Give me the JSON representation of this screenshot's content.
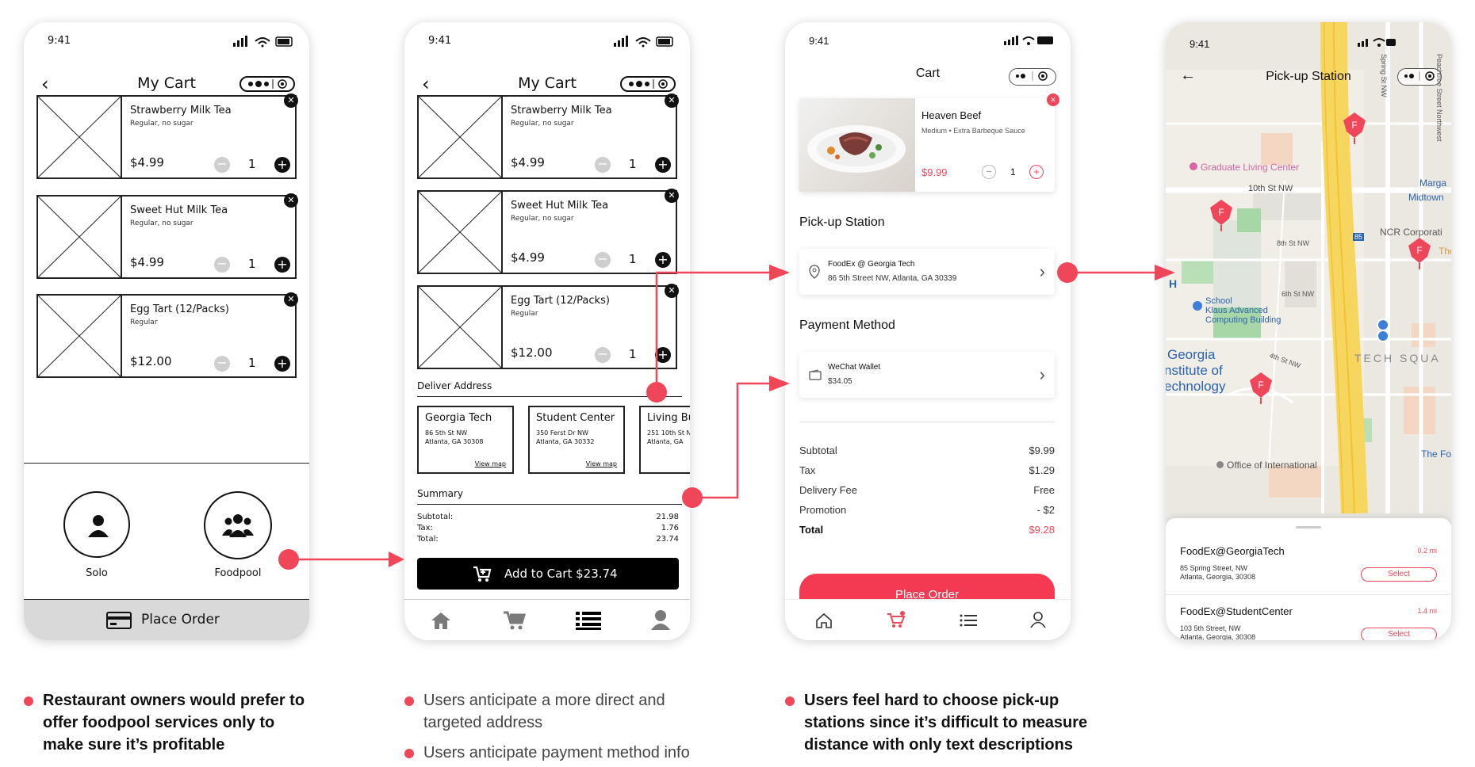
{
  "status_time": "9:41",
  "phone1": {
    "title": "My Cart",
    "items": [
      {
        "name": "Strawberry Milk Tea",
        "option": "Regular, no sugar",
        "price": "$4.99",
        "qty": "1"
      },
      {
        "name": "Sweet Hut Milk Tea",
        "option": "Regular, no sugar",
        "price": "$4.99",
        "qty": "1"
      },
      {
        "name": "Egg Tart (12/Packs)",
        "option": "Regular",
        "price": "$12.00",
        "qty": "1"
      }
    ],
    "options": [
      {
        "label": "Solo",
        "icon": "person-icon"
      },
      {
        "label": "Foodpool",
        "icon": "group-icon"
      }
    ],
    "place_order": "Place Order"
  },
  "phone2": {
    "title": "My Cart",
    "items": [
      {
        "name": "Strawberry Milk Tea",
        "option": "Regular, no sugar",
        "price": "$4.99",
        "qty": "1"
      },
      {
        "name": "Sweet Hut Milk Tea",
        "option": "Regular, no sugar",
        "price": "$4.99",
        "qty": "1"
      },
      {
        "name": "Egg Tart (12/Packs)",
        "option": "Regular",
        "price": "$12.00",
        "qty": "1"
      }
    ],
    "deliver_label": "Deliver Address",
    "addresses": [
      {
        "name": "Georgia Tech",
        "line1": "86 5th St NW",
        "line2": "Atlanta, GA 30308",
        "link": "View map"
      },
      {
        "name": "Student Center",
        "line1": "350 Ferst Dr NW",
        "line2": "Atlanta, GA 30332",
        "link": "View map"
      },
      {
        "name": "Living Bu",
        "line1": "251 10th St N",
        "line2": "Atlanta, GA",
        "link": ""
      }
    ],
    "summary_label": "Summary",
    "summary": [
      {
        "label": "Subtotal:",
        "value": "21.98"
      },
      {
        "label": "Tax:",
        "value": "1.76"
      },
      {
        "label": "Total:",
        "value": "23.74"
      }
    ],
    "add_to_cart": "Add to Cart $23.74",
    "nav": [
      "home-icon",
      "cart-icon",
      "list-icon",
      "user-icon"
    ]
  },
  "phone3": {
    "title": "Cart",
    "item": {
      "name": "Heaven Beef",
      "option1": "Medium",
      "option2": "Extra Barbeque Sauce",
      "price": "$9.99",
      "qty": "1"
    },
    "pickup_label": "Pick-up Station",
    "station_name": "FoodEx @ Georgia Tech",
    "station_addr": "86 5th Street NW, Atlanta, GA 30339",
    "payment_label": "Payment Method",
    "payment_name": "WeChat Wallet",
    "payment_amount": "$34.05",
    "summary": [
      {
        "label": "Subtotal",
        "value": "$9.99"
      },
      {
        "label": "Tax",
        "value": "$1.29"
      },
      {
        "label": "Delivery Fee",
        "value": "Free"
      },
      {
        "label": "Promotion",
        "value": "- $2"
      }
    ],
    "total_label": "Total",
    "total_value": "$9.28",
    "place_order": "Place Order"
  },
  "phone4": {
    "title": "Pick-up Station",
    "map_labels": {
      "graduate": "Graduate Living Center",
      "tenth": "10th St NW",
      "marga": "Marga",
      "midtown": "Midtown",
      "ncr": "NCR Corporati",
      "school": "School",
      "klaus1": "Klaus Advanced",
      "klaus2": "Computing Building",
      "georgia1": "Georgia",
      "georgia2": "nstitute of",
      "georgia3": "echnology",
      "tech": "TECH SQUA",
      "office": "Office of International",
      "thefo": "The Fo",
      "peachtree": "Peachtree Street Northwest",
      "spring": "Spring St NW",
      "eighth": "8th St NW",
      "sixth": "6th St NW",
      "fourth": "4th St NW",
      "interstate": "85",
      "h": "H",
      "the": "The"
    },
    "stations": [
      {
        "name": "FoodEx@GeorgiaTech",
        "dist": "0.2 mi",
        "line1": "85 Spring Street, NW",
        "line2": "Atlanta, Georgia, 30308",
        "button": "Select"
      },
      {
        "name": "FoodEx@StudentCenter",
        "dist": "1.4 mi",
        "line1": "103 5th Street, NW",
        "line2": "Atlanta, Georgia, 30308",
        "button": "Select"
      }
    ]
  },
  "notes": {
    "n1": [
      "Restaurant owners would prefer to",
      "offer foodpool services only to",
      "make sure it’s profitable"
    ],
    "n2a": [
      "Users anticipate a more direct and",
      "targeted address"
    ],
    "n2b": [
      "Users anticipate payment method info"
    ],
    "n3": [
      "Users feel hard to choose pick-up",
      "stations since it’s difficult to measure",
      "distance with only text descriptions"
    ]
  },
  "colors": {
    "accent": "#f0465a",
    "map_highway": "#f6d65e"
  }
}
